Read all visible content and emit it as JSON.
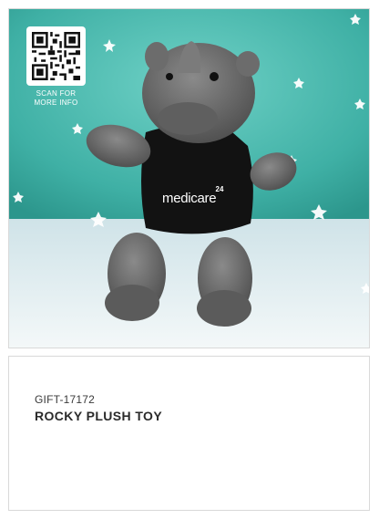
{
  "qr": {
    "caption_line1": "SCAN FOR",
    "caption_line2": "MORE INFO"
  },
  "shirt": {
    "logo_text": "medicare",
    "logo_badge": "24"
  },
  "product": {
    "code": "GIFT-17172",
    "name": "ROCKY PLUSH TOY"
  },
  "colors": {
    "backdrop": "#4fbfb3",
    "floor": "#e6eef0",
    "plush_grey": "#6a6a6a",
    "shirt": "#121212"
  }
}
